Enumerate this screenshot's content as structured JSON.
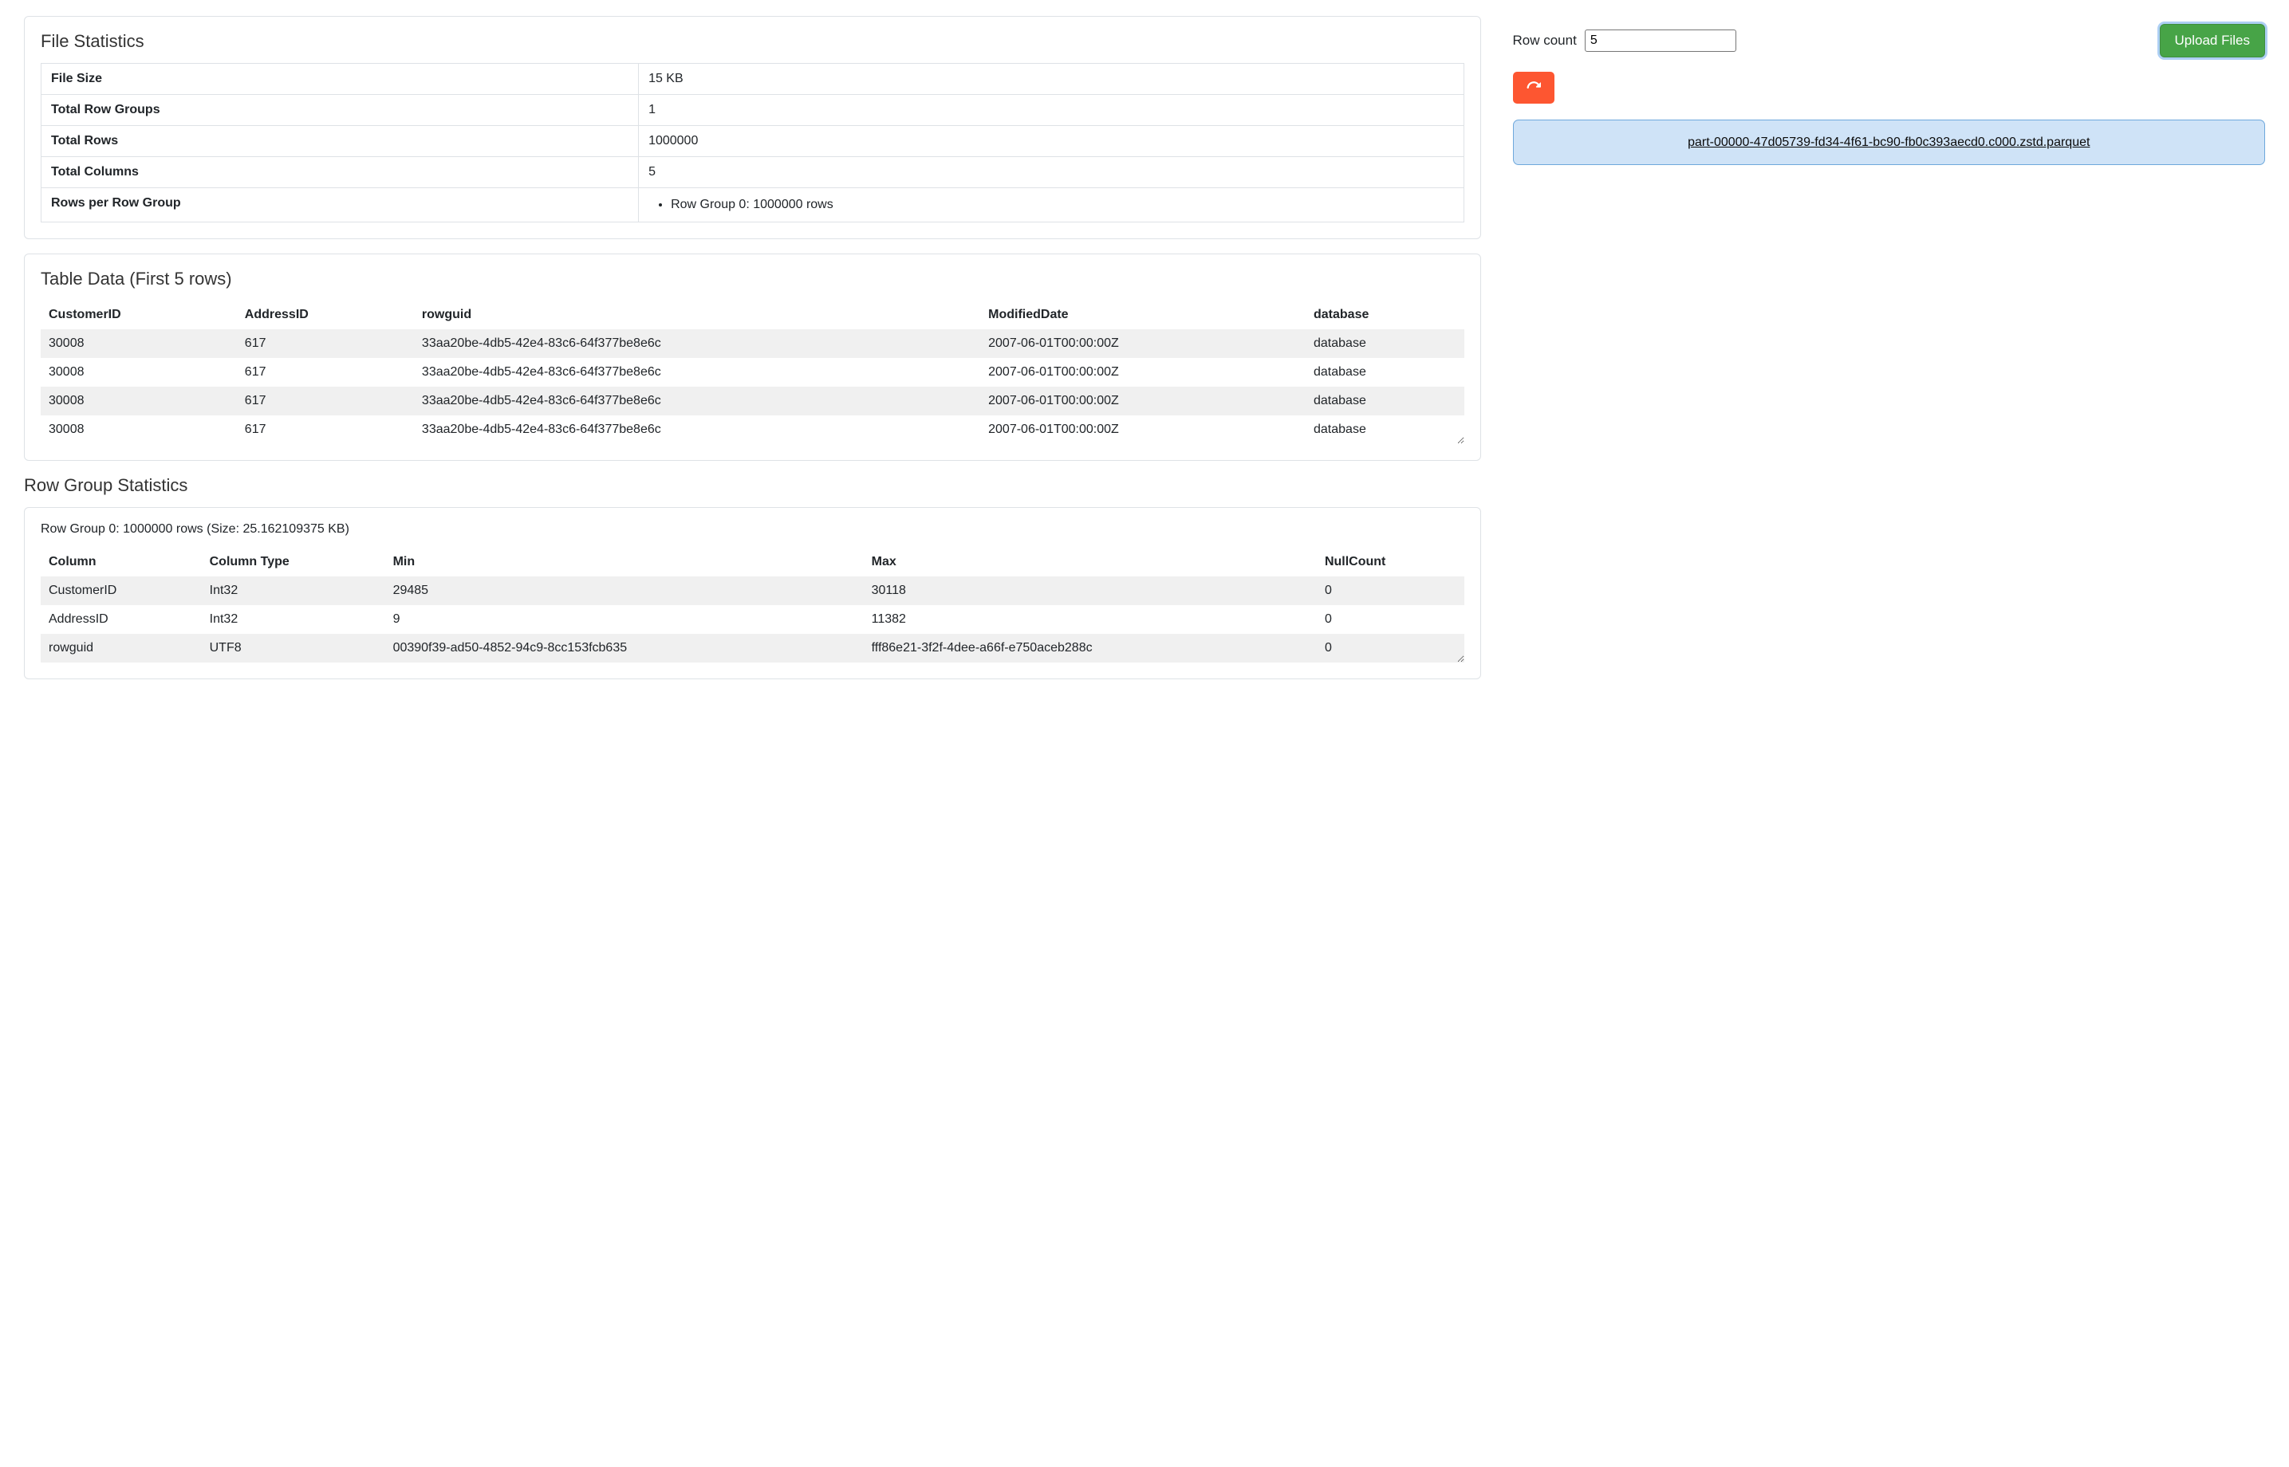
{
  "file_stats": {
    "title": "File Statistics",
    "rows": [
      {
        "label": "File Size",
        "value": "15 KB"
      },
      {
        "label": "Total Row Groups",
        "value": "1"
      },
      {
        "label": "Total Rows",
        "value": "1000000"
      },
      {
        "label": "Total Columns",
        "value": "5"
      }
    ],
    "rows_per_group_label": "Rows per Row Group",
    "row_groups": [
      "Row Group 0: 1000000 rows"
    ]
  },
  "table_data": {
    "title": "Table Data (First 5 rows)",
    "headers": [
      "CustomerID",
      "AddressID",
      "rowguid",
      "ModifiedDate",
      "database"
    ],
    "rows": [
      [
        "30008",
        "617",
        "33aa20be-4db5-42e4-83c6-64f377be8e6c",
        "2007-06-01T00:00:00Z",
        "database"
      ],
      [
        "30008",
        "617",
        "33aa20be-4db5-42e4-83c6-64f377be8e6c",
        "2007-06-01T00:00:00Z",
        "database"
      ],
      [
        "30008",
        "617",
        "33aa20be-4db5-42e4-83c6-64f377be8e6c",
        "2007-06-01T00:00:00Z",
        "database"
      ],
      [
        "30008",
        "617",
        "33aa20be-4db5-42e4-83c6-64f377be8e6c",
        "2007-06-01T00:00:00Z",
        "database"
      ]
    ]
  },
  "row_group_stats": {
    "title": "Row Group Statistics",
    "group_header": "Row Group 0: 1000000 rows (Size: 25.162109375 KB)",
    "headers": [
      "Column",
      "Column Type",
      "Min",
      "Max",
      "NullCount"
    ],
    "rows": [
      [
        "CustomerID",
        "Int32",
        "29485",
        "30118",
        "0"
      ],
      [
        "AddressID",
        "Int32",
        "9",
        "11382",
        "0"
      ],
      [
        "rowguid",
        "UTF8",
        "00390f39-ad50-4852-94c9-8cc153fcb635",
        "fff86e21-3f2f-4dee-a66f-e750aceb288c",
        "0"
      ]
    ]
  },
  "side": {
    "row_count_label": "Row count",
    "row_count_value": "5",
    "upload_label": "Upload Files",
    "redo_icon": "redo-icon",
    "file_name": "part-00000-47d05739-fd34-4f61-bc90-fb0c393aecd0.c000.zstd.parquet"
  }
}
